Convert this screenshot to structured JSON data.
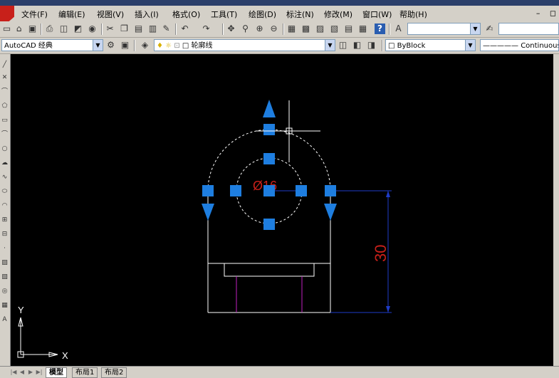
{
  "menu": [
    "文件(F)",
    "编辑(E)",
    "视图(V)",
    "插入(I)",
    "格式(O)",
    "工具(T)",
    "绘图(D)",
    "标注(N)",
    "修改(M)",
    "窗口(W)",
    "帮助(H)"
  ],
  "window_controls": [
    "–",
    "◻"
  ],
  "workspace": {
    "value": "AutoCAD 经典"
  },
  "layer": {
    "value": "轮廓线"
  },
  "color": {
    "value": "ByBlock"
  },
  "linetype": {
    "value": "Continuous"
  },
  "drawing": {
    "diameter_label": "Ø16",
    "dimension_label": "30",
    "ucs_y": "Y",
    "ucs_x": "X",
    "colors": {
      "background": "#000000",
      "line": "#ffffff",
      "grip": "#1e7ee0",
      "dimension": "#1e3cc8",
      "dim_text": "#c8201a",
      "hidden": "#c020c0"
    }
  },
  "tabs": [
    "模型",
    "布局1",
    "布局2"
  ],
  "icons": {
    "toolbar1": [
      "new-icon",
      "open-icon",
      "save-icon",
      "print-icon",
      "preview-icon",
      "publish-icon",
      "plot-icon",
      "cut-icon",
      "copy-icon",
      "paste-icon",
      "matchprop-icon",
      "undo-icon",
      "redo-icon",
      "pan-icon",
      "zoom-realtime-icon",
      "zoom-window-icon",
      "zoom-previous-icon",
      "properties-icon",
      "designcenter-icon",
      "toolpalette-icon",
      "sheetset-icon",
      "markup-icon",
      "calc-icon",
      "help-icon",
      "textstyle-icon",
      "dimstyle-icon"
    ],
    "toolbar2": [
      "workspace-settings-icon",
      "workspace-icon",
      "layer-manager-icon",
      "layer-on-icon",
      "layer-freeze-icon",
      "layer-lock-icon",
      "layer-color-icon",
      "make-current-icon",
      "layer-previous-icon"
    ]
  }
}
